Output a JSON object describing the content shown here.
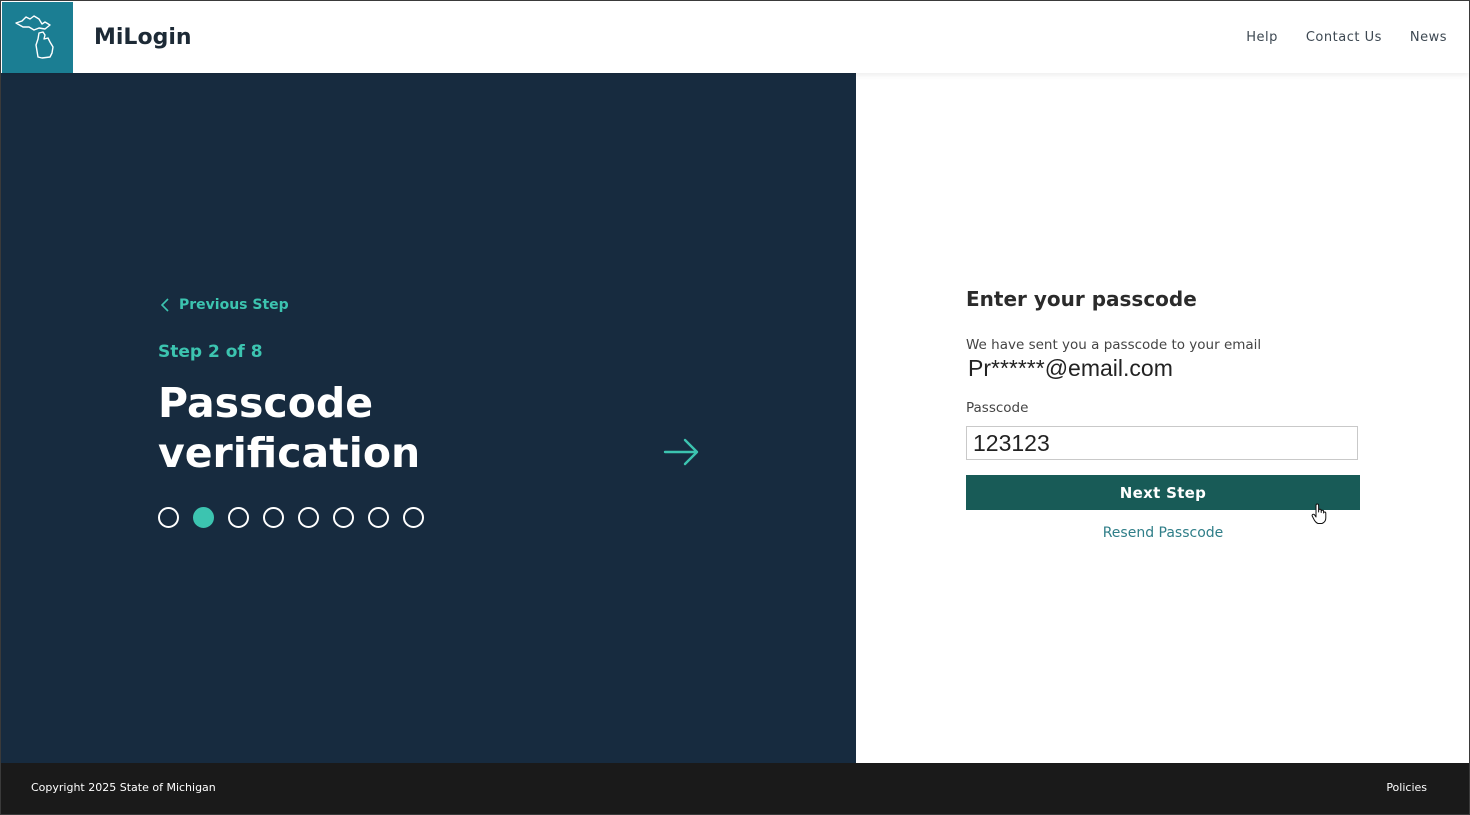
{
  "header": {
    "brand": "MiLogin",
    "nav": [
      "Help",
      "Contact Us",
      "News"
    ]
  },
  "left": {
    "previous_step": "Previous Step",
    "step_label": "Step 2 of 8",
    "title_line1": "Passcode",
    "title_line2": "verification",
    "progress": {
      "current": 2,
      "total": 8
    }
  },
  "form": {
    "title": "Enter your passcode",
    "sent_message": "We have sent you a passcode to your email",
    "email": "Pr******@email.com",
    "passcode_label": "Passcode",
    "passcode_value": "123123",
    "next_button": "Next Step",
    "resend_link": "Resend Passcode"
  },
  "footer": {
    "copyright": "Copyright 2025 State of Michigan",
    "policies": "Policies"
  },
  "colors": {
    "accent": "#3cc4b0",
    "left_panel": "#172b3f",
    "button": "#185b57",
    "logo_bg": "#1b7e93"
  }
}
